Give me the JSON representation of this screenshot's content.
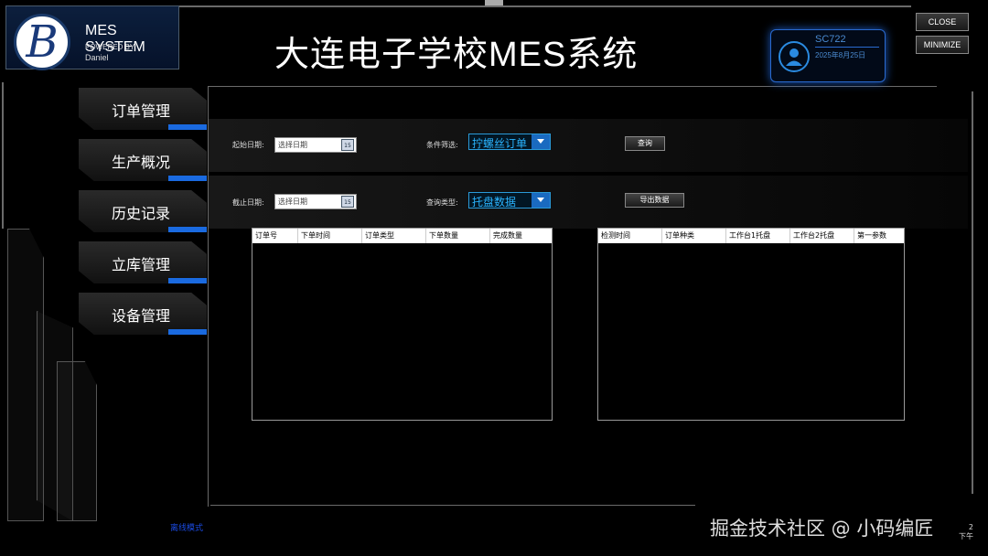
{
  "app": {
    "logo_letter": "B",
    "logo_title": "MES SYSTEM",
    "powered_by": "POWERED BY:",
    "author": "Daniel",
    "title_cn": "大连电子学校",
    "title_mes": "MES",
    "title_cn2": "系统"
  },
  "user": {
    "name": "SC722",
    "date": "2025年8月25日"
  },
  "window": {
    "close_label": "CLOSE",
    "minimize_label": "MINIMIZE"
  },
  "menu": {
    "items": [
      {
        "label": "订单管理"
      },
      {
        "label": "生产概况"
      },
      {
        "label": "历史记录"
      },
      {
        "label": "立库管理"
      },
      {
        "label": "设备管理"
      }
    ]
  },
  "filters": {
    "start_label": "起始日期:",
    "start_placeholder": "选择日期",
    "end_label": "截止日期:",
    "end_placeholder": "选择日期",
    "calendar_glyph": "15",
    "condition_label": "条件筛选:",
    "condition_value": "拧螺丝订单",
    "query_type_label": "查询类型:",
    "query_type_value": "托盘数据",
    "query_button": "查询",
    "export_button": "导出数据"
  },
  "order_table": {
    "columns": [
      "订单号",
      "下单时间",
      "订单类型",
      "下单数量",
      "完成数量"
    ]
  },
  "inspection_table": {
    "columns": [
      "检测时间",
      "订单种类",
      "工作台1托盘",
      "工作台2托盘",
      "第一参数"
    ]
  },
  "status": {
    "offline": "离线模式"
  },
  "watermark": "掘金技术社区 @ 小码编匠",
  "corner": {
    "line1": "2",
    "line2": "下午"
  },
  "colors": {
    "accent": "#1a6ae0",
    "combo_text": "#2ab4ff",
    "user_text": "#4a8ad0"
  }
}
